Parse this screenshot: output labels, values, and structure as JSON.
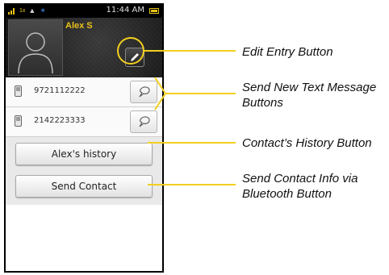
{
  "status_bar": {
    "time": "11:44 AM",
    "signal_tag": "1x"
  },
  "contact": {
    "name": "Alex S"
  },
  "phone_rows": [
    {
      "number": "9721112222",
      "message_icon": "speech-bubble-icon",
      "type_icon": "mobile-phone-icon"
    },
    {
      "number": "2142223333",
      "message_icon": "speech-bubble-icon",
      "type_icon": "mobile-phone-icon"
    }
  ],
  "buttons": {
    "history_label": "Alex's history",
    "send_contact_label": "Send Contact"
  },
  "callouts": {
    "edit_entry": "Edit Entry Button",
    "send_text_line1": "Send New Text Message",
    "send_text_line2": "Buttons",
    "history": "Contact’s History Button",
    "bluetooth_line1": "Send Contact Info via",
    "bluetooth_line2": "Bluetooth Button"
  },
  "colors": {
    "accent": "#f2cf1f",
    "name_text": "#e8c21a",
    "header_bg": "#1c1c1c"
  }
}
